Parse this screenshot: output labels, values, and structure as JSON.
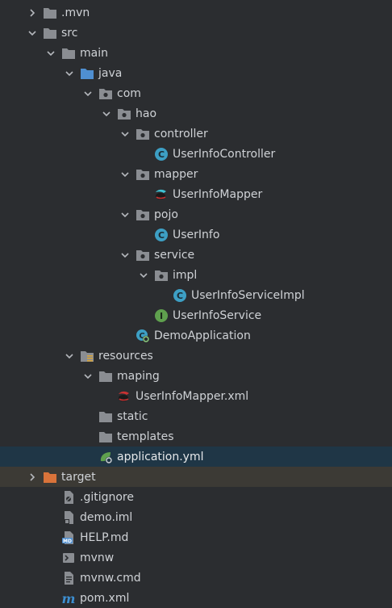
{
  "tree": {
    "items": [
      {
        "label": ".mvn",
        "level": 0,
        "arrow": "right",
        "icon": "folder-icon"
      },
      {
        "label": "src",
        "level": 0,
        "arrow": "down",
        "icon": "folder-icon"
      },
      {
        "label": "main",
        "level": 1,
        "arrow": "down",
        "icon": "folder-icon"
      },
      {
        "label": "java",
        "level": 2,
        "arrow": "down",
        "icon": "source-folder-icon"
      },
      {
        "label": "com",
        "level": 3,
        "arrow": "down",
        "icon": "package-icon"
      },
      {
        "label": "hao",
        "level": 4,
        "arrow": "down",
        "icon": "package-icon"
      },
      {
        "label": "controller",
        "level": 5,
        "arrow": "down",
        "icon": "package-icon"
      },
      {
        "label": "UserInfoController",
        "level": 6,
        "arrow": "none",
        "icon": "class-icon"
      },
      {
        "label": "mapper",
        "level": 5,
        "arrow": "down",
        "icon": "package-icon"
      },
      {
        "label": "UserInfoMapper",
        "level": 6,
        "arrow": "none",
        "icon": "mybatis-mapper-icon"
      },
      {
        "label": "pojo",
        "level": 5,
        "arrow": "down",
        "icon": "package-icon"
      },
      {
        "label": "UserInfo",
        "level": 6,
        "arrow": "none",
        "icon": "class-icon"
      },
      {
        "label": "service",
        "level": 5,
        "arrow": "down",
        "icon": "package-icon"
      },
      {
        "label": "impl",
        "level": 6,
        "arrow": "down",
        "icon": "package-icon"
      },
      {
        "label": "UserInfoServiceImpl",
        "level": 7,
        "arrow": "none",
        "icon": "class-icon"
      },
      {
        "label": "UserInfoService",
        "level": 6,
        "arrow": "none",
        "icon": "interface-icon"
      },
      {
        "label": "DemoApplication",
        "level": 5,
        "arrow": "none",
        "icon": "spring-boot-app-icon"
      },
      {
        "label": "resources",
        "level": 2,
        "arrow": "down",
        "icon": "resources-folder-icon"
      },
      {
        "label": "maping",
        "level": 3,
        "arrow": "down",
        "icon": "folder-icon"
      },
      {
        "label": "UserInfoMapper.xml",
        "level": 4,
        "arrow": "none",
        "icon": "mybatis-xml-icon"
      },
      {
        "label": "static",
        "level": 3,
        "arrow": "none",
        "icon": "folder-icon"
      },
      {
        "label": "templates",
        "level": 3,
        "arrow": "none",
        "icon": "folder-icon"
      },
      {
        "label": "application.yml",
        "level": 3,
        "arrow": "none",
        "icon": "spring-config-icon",
        "selected": true
      },
      {
        "label": "target",
        "level": 0,
        "arrow": "right",
        "icon": "excluded-folder-icon",
        "excluded": true
      },
      {
        "label": ".gitignore",
        "level": 1,
        "arrow": "none",
        "icon": "gitignore-file-icon"
      },
      {
        "label": "demo.iml",
        "level": 1,
        "arrow": "none",
        "icon": "iml-file-icon"
      },
      {
        "label": "HELP.md",
        "level": 1,
        "arrow": "none",
        "icon": "markdown-file-icon"
      },
      {
        "label": "mvnw",
        "level": 1,
        "arrow": "none",
        "icon": "shell-script-icon"
      },
      {
        "label": "mvnw.cmd",
        "level": 1,
        "arrow": "none",
        "icon": "text-file-icon"
      },
      {
        "label": "pom.xml",
        "level": 1,
        "arrow": "none",
        "icon": "maven-pom-icon"
      }
    ]
  },
  "colors": {
    "background": "#2b2d30",
    "selected_row": "#1f3646",
    "excluded_row": "#3c3a35",
    "folder": "#8a8d92",
    "source_folder": "#4f8fd1",
    "class_icon": "#3d9fc4",
    "interface_icon": "#5fa04e",
    "excluded_folder": "#d9733a",
    "spring": "#5fa04e"
  }
}
